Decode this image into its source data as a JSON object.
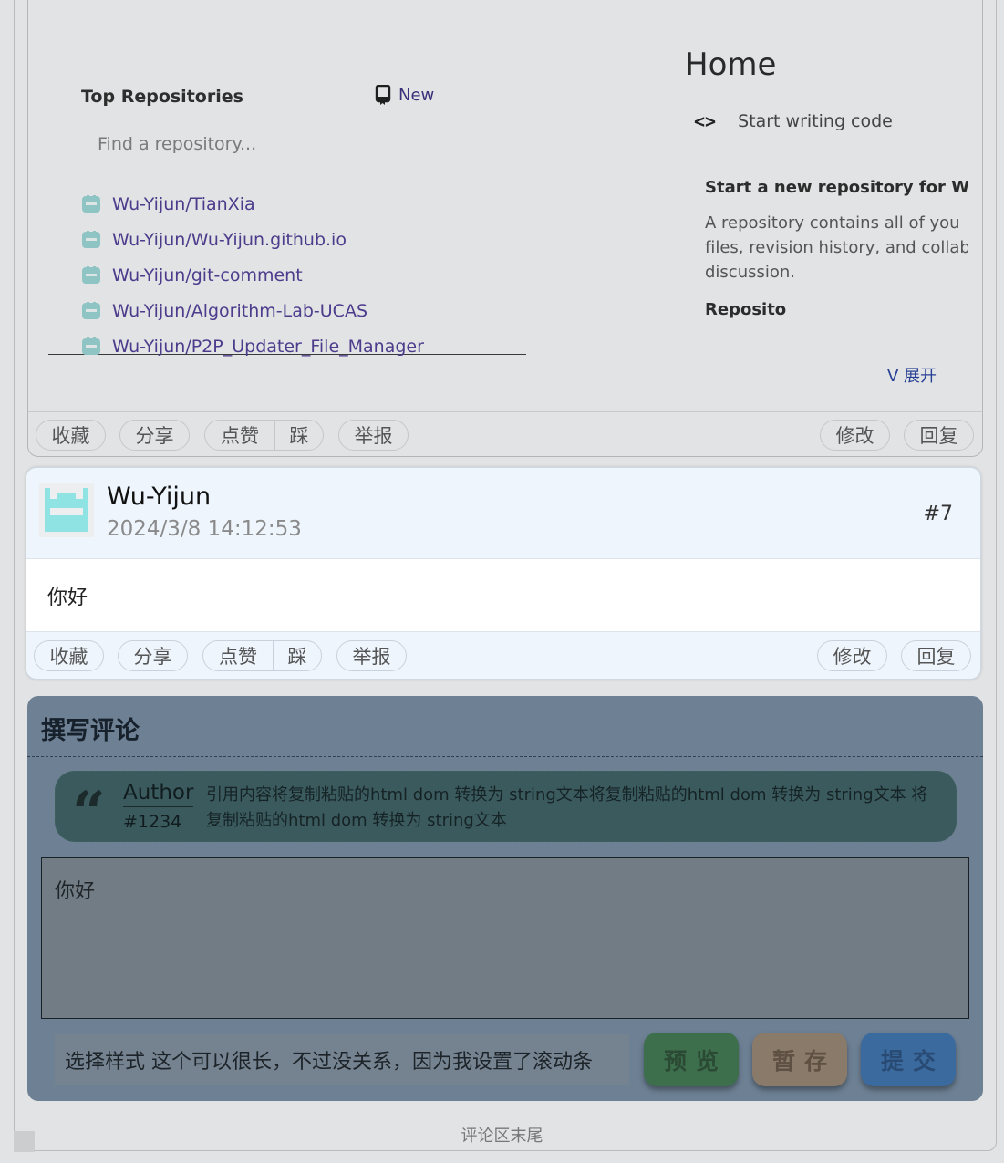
{
  "prev_comment": {
    "repo_panel": {
      "title": "Top Repositories",
      "new_label": "New",
      "search_placeholder": "Find a repository...",
      "repos": [
        "Wu-Yijun/TianXia",
        "Wu-Yijun/Wu-Yijun.github.io",
        "Wu-Yijun/git-comment",
        "Wu-Yijun/Algorithm-Lab-UCAS",
        "Wu-Yijun/P2P_Updater_File_Manager"
      ]
    },
    "home_panel": {
      "title": "Home",
      "code_label": "Start writing code",
      "start_title": "Start a new repository for Wu-",
      "description_lines": [
        "A repository contains all of you",
        "files, revision history, and collab",
        "discussion."
      ],
      "repo_label": "Reposito"
    },
    "expand_label": "V 展开",
    "actions": {
      "favorite": "收藏",
      "share": "分享",
      "like": "点赞",
      "dislike": "踩",
      "report": "举报",
      "edit": "修改",
      "reply": "回复"
    }
  },
  "highlight_comment": {
    "username": "Wu-Yijun",
    "timestamp": "2024/3/8 14:12:53",
    "number": "#7",
    "content": "你好",
    "actions": {
      "favorite": "收藏",
      "share": "分享",
      "like": "点赞",
      "dislike": "踩",
      "report": "举报",
      "edit": "修改",
      "reply": "回复"
    }
  },
  "compose": {
    "title": "撰写评论",
    "quote": {
      "author": "Author",
      "id": "#1234",
      "text": "引用内容将复制粘贴的html dom 转换为 string文本将复制粘贴的html dom 转换为 string文本 将复制粘贴的html dom 转换为 string文本"
    },
    "textarea_value": "你好",
    "style_select": "选择样式 这个可以很长，不过没关系，因为我设置了滚动条",
    "buttons": {
      "preview": "预览",
      "draft": "暂存",
      "submit": "提交"
    }
  },
  "footer_text": "评论区末尾",
  "colors": {
    "highlight_bg": "#eef5fd",
    "compose_bg": "#6d8094",
    "preview_btn": "#3e6f4d",
    "draft_btn": "#8a7a6a",
    "submit_btn": "#3b6a9f",
    "repo_link": "#4d3b8c"
  },
  "icons": {
    "repo_new": "repo-book-icon",
    "code": "code-brackets-icon",
    "quote": "quote-mark-icon",
    "avatar": "identicon-avatar"
  }
}
